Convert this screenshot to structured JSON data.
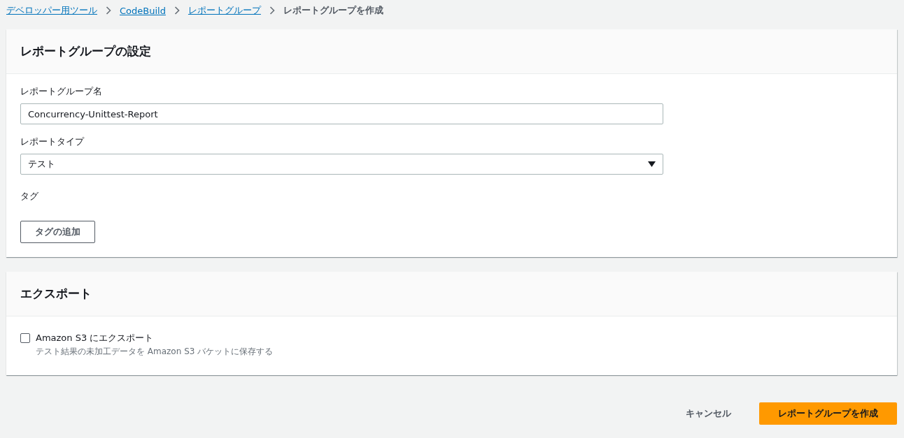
{
  "breadcrumb": [
    {
      "label": "デベロッパー用ツール",
      "kind": "link"
    },
    {
      "label": "CodeBuild",
      "kind": "link"
    },
    {
      "label": "レポートグループ",
      "kind": "link"
    },
    {
      "label": "レポートグループを作成",
      "kind": "current"
    }
  ],
  "settings": {
    "title": "レポートグループの設定",
    "name_label": "レポートグループ名",
    "name_value": "Concurrency-Unittest-Report",
    "type_label": "レポートタイプ",
    "type_value": "テスト",
    "tags_label": "タグ",
    "add_tag_button": "タグの追加"
  },
  "export": {
    "title": "エクスポート",
    "checkbox": {
      "label": "Amazon S3 にエクスポート",
      "description": "テスト結果の未加工データを Amazon S3 バケットに保存する",
      "checked": false
    }
  },
  "actions": {
    "cancel": "キャンセル",
    "submit": "レポートグループを作成"
  }
}
